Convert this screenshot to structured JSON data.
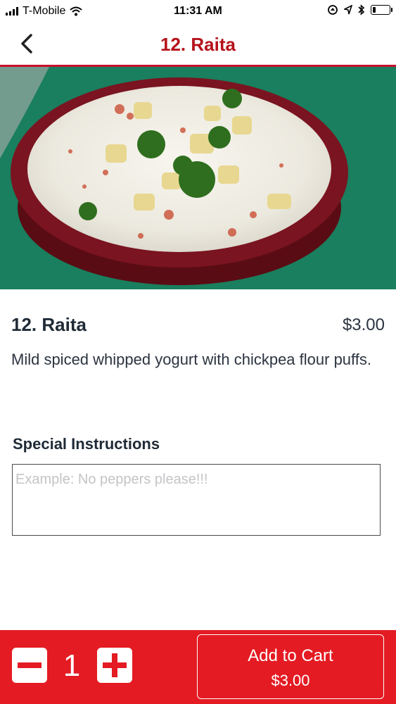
{
  "status_bar": {
    "carrier": "T-Mobile",
    "time": "11:31 AM",
    "battery_level": 0.2,
    "icons": [
      "signal-icon",
      "wifi-icon",
      "location-lock-icon",
      "location-arrow-icon",
      "bluetooth-icon",
      "battery-icon"
    ]
  },
  "nav": {
    "title": "12. Raita",
    "back_icon": "chevron-left-icon"
  },
  "item": {
    "name": "12. Raita",
    "price": "$3.00",
    "description": "Mild spiced whipped yogurt with chickpea flour puffs."
  },
  "instructions": {
    "label": "Special Instructions",
    "placeholder": "Example: No peppers please!!!",
    "value": ""
  },
  "cart": {
    "quantity": "1",
    "add_label": "Add to Cart",
    "total": "$3.00"
  },
  "colors": {
    "brand_red": "#e41b23",
    "title_red": "#b5121b"
  }
}
